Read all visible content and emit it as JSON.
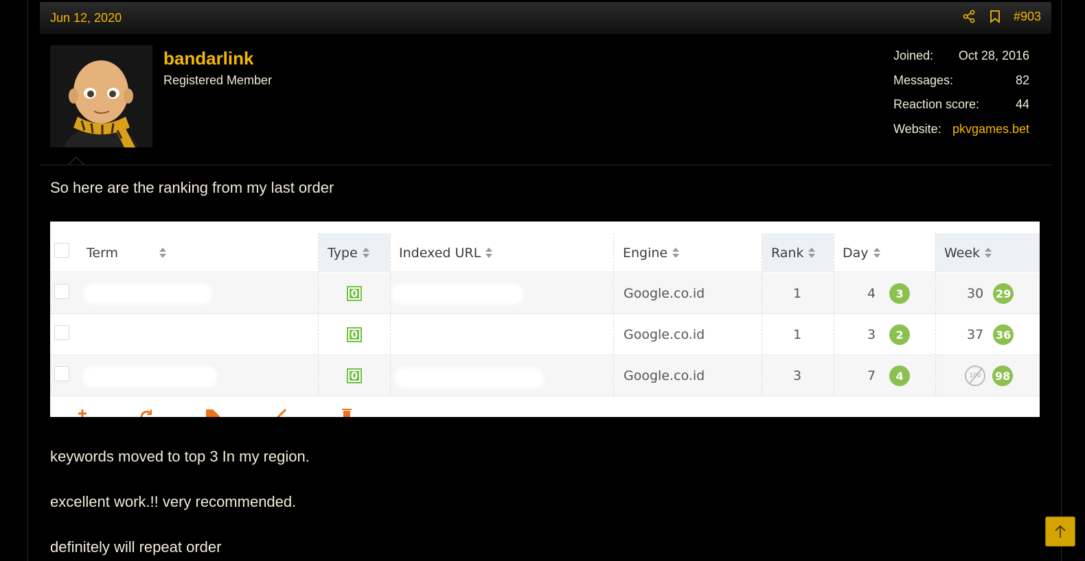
{
  "post": {
    "date": "Jun 12, 2020",
    "post_number": "#903",
    "icons": {
      "share": "share-icon",
      "bookmark": "bookmark-icon",
      "scroll_top": "arrow-up-icon"
    }
  },
  "user": {
    "name": "bandarlink",
    "title": "Registered Member",
    "stats": [
      {
        "label": "Joined:",
        "value": "Oct 28, 2016"
      },
      {
        "label": "Messages:",
        "value": "82"
      },
      {
        "label": "Reaction score:",
        "value": "44"
      },
      {
        "label": "Website:",
        "value": "pkvgames.bet"
      }
    ]
  },
  "message": {
    "intro": "So here are the ranking from my last order",
    "lines": [
      "keywords moved to top 3 In my region.",
      "excellent work.!! very recommended.",
      "definitely will repeat order"
    ]
  },
  "ranking_table": {
    "headers": [
      "Term",
      "Type",
      "Indexed URL",
      "Engine",
      "Rank",
      "Day",
      "Week"
    ],
    "rows": [
      {
        "type": "0",
        "engine": "Google.co.id",
        "rank": "1",
        "day": "4",
        "day_change": "3",
        "week": "30",
        "week_change": "29"
      },
      {
        "type": "0",
        "engine": "Google.co.id",
        "rank": "1",
        "day": "3",
        "day_change": "2",
        "week": "37",
        "week_change": "36"
      },
      {
        "type": "0",
        "engine": "Google.co.id",
        "rank": "3",
        "day": "7",
        "day_change": "4",
        "week": "",
        "week_na": "100",
        "week_change": "98"
      }
    ]
  },
  "colors": {
    "accent": "#f5b800",
    "background": "#000000",
    "text": "#f2ecd9",
    "badge_green": "#8cc04f"
  }
}
